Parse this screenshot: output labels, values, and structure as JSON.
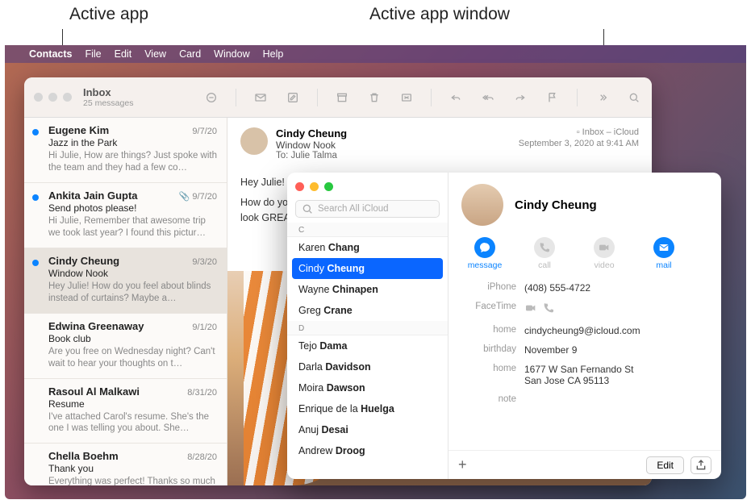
{
  "annotations": {
    "active_app": "Active app",
    "active_window": "Active app window"
  },
  "menubar": {
    "app": "Contacts",
    "items": [
      "File",
      "Edit",
      "View",
      "Card",
      "Window",
      "Help"
    ]
  },
  "mail": {
    "inbox_label": "Inbox",
    "message_count": "25 messages",
    "header": {
      "from": "Cindy Cheung",
      "subject": "Window Nook",
      "to_label": "To:",
      "to": "Julie Talma",
      "mailbox": "Inbox – iCloud",
      "mailbox_icon": "tray-icon",
      "date": "September 3, 2020 at 9:41 AM"
    },
    "body_line1": "Hey Julie!",
    "body_line2": "How do you feel about blinds instead of curtains? Maybe a natural wood look GREAT",
    "messages": [
      {
        "from": "Eugene Kim",
        "date": "9/7/20",
        "subject": "Jazz in the Park",
        "preview": "Hi Julie, How are things? Just spoke with the team and they had a few co…",
        "unread": true,
        "attachment": false
      },
      {
        "from": "Ankita Jain Gupta",
        "date": "9/7/20",
        "subject": "Send photos please!",
        "preview": "Hi Julie, Remember that awesome trip we took last year? I found this pictur…",
        "unread": true,
        "attachment": true
      },
      {
        "from": "Cindy Cheung",
        "date": "9/3/20",
        "subject": "Window Nook",
        "preview": "Hey Julie! How do you feel about blinds instead of curtains? Maybe a…",
        "unread": true,
        "attachment": false,
        "selected": true
      },
      {
        "from": "Edwina Greenaway",
        "date": "9/1/20",
        "subject": "Book club",
        "preview": "Are you free on Wednesday night? Can't wait to hear your thoughts on t…",
        "unread": false,
        "attachment": false
      },
      {
        "from": "Rasoul Al Malkawi",
        "date": "8/31/20",
        "subject": "Resume",
        "preview": "I've attached Carol's resume. She's the one I was telling you about. She…",
        "unread": false,
        "attachment": false
      },
      {
        "from": "Chella Boehm",
        "date": "8/28/20",
        "subject": "Thank you",
        "preview": "Everything was perfect! Thanks so much for helping out. The day was a…",
        "unread": false,
        "attachment": false
      }
    ]
  },
  "contacts": {
    "search_placeholder": "Search All iCloud",
    "sections": [
      {
        "letter": "C",
        "names": [
          "Karen Chang",
          "Cindy Cheung",
          "Wayne Chinapen",
          "Greg Crane"
        ]
      },
      {
        "letter": "D",
        "names": [
          "Tejo Dama",
          "Darla Davidson",
          "Moira Dawson",
          "Enrique de la Huelga",
          "Anuj Desai",
          "Andrew Droog"
        ]
      }
    ],
    "selected_name": "Cindy Cheung",
    "card": {
      "name": "Cindy Cheung",
      "actions": {
        "message": "message",
        "call": "call",
        "video": "video",
        "mail": "mail"
      },
      "fields": {
        "iphone_label": "iPhone",
        "iphone": "(408) 555-4722",
        "facetime_label": "FaceTime",
        "home_email_label": "home",
        "home_email": "cindycheung9@icloud.com",
        "birthday_label": "birthday",
        "birthday": "November 9",
        "home_addr_label": "home",
        "home_addr1": "1677 W San Fernando St",
        "home_addr2": "San Jose CA 95113",
        "note_label": "note"
      },
      "edit_label": "Edit"
    }
  }
}
